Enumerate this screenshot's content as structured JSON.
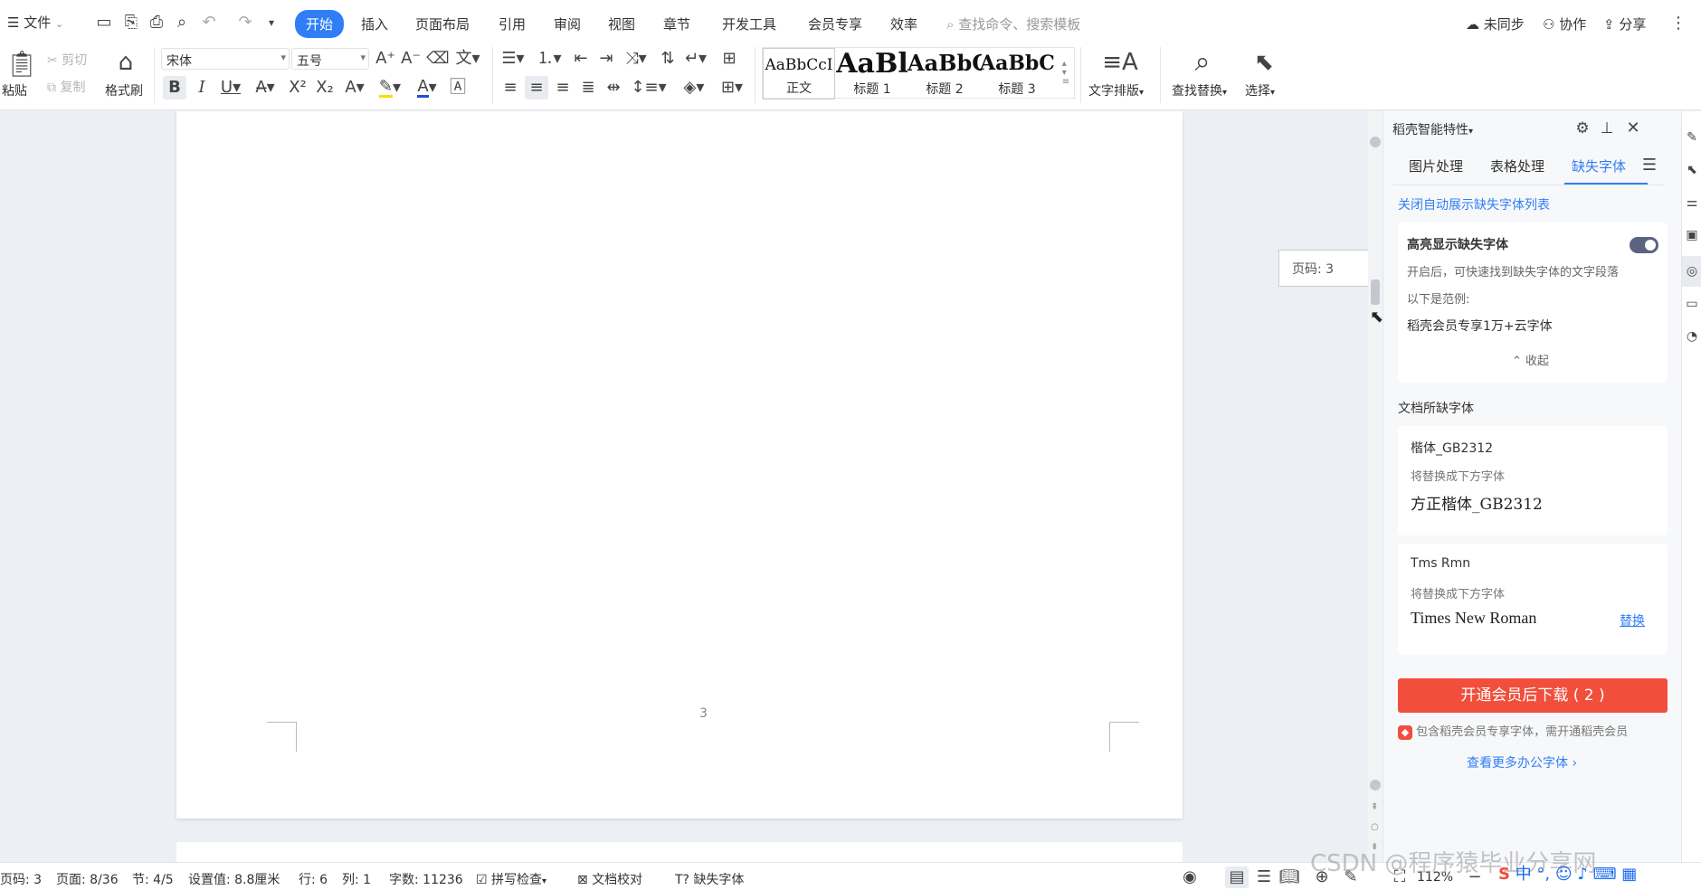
{
  "menubar": {
    "file": "文件",
    "tabs": [
      "开始",
      "插入",
      "页面布局",
      "引用",
      "审阅",
      "视图",
      "章节",
      "开发工具",
      "会员专享",
      "效率"
    ],
    "search_placeholder": "查找命令、搜索模板",
    "sync": "未同步",
    "collab": "协作",
    "share": "分享"
  },
  "ribbon": {
    "paste": "粘贴",
    "cut": "剪切",
    "copy": "复制",
    "format_painter": "格式刷",
    "font_name": "宋体",
    "font_size": "五号",
    "styles": [
      {
        "sample": "AaBbCcI",
        "name": "正文"
      },
      {
        "sample": "AaBl",
        "name": "标题 1"
      },
      {
        "sample": "AaBbC",
        "name": "标题 2"
      },
      {
        "sample": "AaBbC",
        "name": "标题 3"
      }
    ],
    "text_layout": "文字排版",
    "find_replace": "查找替换",
    "select": "选择"
  },
  "document": {
    "page_number": "3",
    "tooltip": "页码: 3"
  },
  "panel": {
    "title": "稻壳智能特性",
    "tabs": [
      "图片处理",
      "表格处理",
      "缺失字体"
    ],
    "active_tab": "缺失字体",
    "close_auto_link": "关闭自动展示缺失字体列表",
    "highlight_title": "高亮显示缺失字体",
    "highlight_desc": "开启后，可快速找到缺失字体的文字段落",
    "example_label": "以下是范例:",
    "example_text": "稻壳会员专享1万+云字体",
    "collapse": "收起",
    "missing_header": "文档所缺字体",
    "fonts": [
      {
        "name": "楷体_GB2312",
        "replace_label": "将替换成下方字体",
        "replacement": "方正楷体_GB2312",
        "action": ""
      },
      {
        "name": "Tms Rmn",
        "replace_label": "将替换成下方字体",
        "replacement": "Times New Roman",
        "action": "替换"
      }
    ],
    "download_button": "开通会员后下载 ( 2 )",
    "vip_note": "包含稻壳会员专享字体，需开通稻壳会员",
    "more_link": "查看更多办公字体"
  },
  "statusbar": {
    "page": "页码: 3",
    "pages": "页面: 8/36",
    "section": "节: 4/5",
    "setting": "设置值: 8.8厘米",
    "row": "行: 6",
    "col": "列: 1",
    "words": "字数: 11236",
    "spellcheck": "拼写检查",
    "proofread": "文档校对",
    "missing_font": "缺失字体",
    "zoom": "112%"
  },
  "watermark": "CSDN @程序猿毕业分享网",
  "colors": {
    "accent": "#2f7ef5",
    "download": "#f14e3b",
    "link": "#2f7ef5"
  }
}
